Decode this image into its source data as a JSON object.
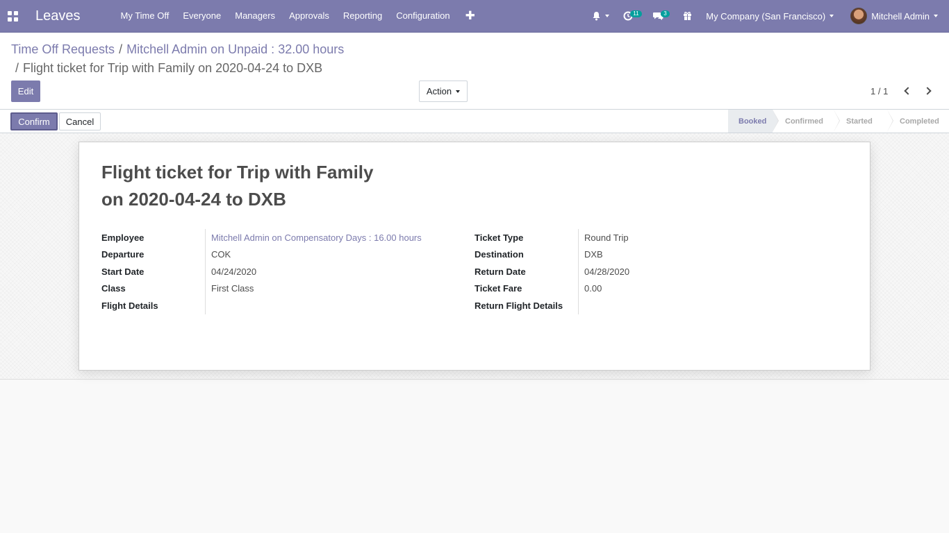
{
  "app": {
    "name": "Leaves"
  },
  "menu": [
    {
      "label": "My Time Off"
    },
    {
      "label": "Everyone"
    },
    {
      "label": "Managers"
    },
    {
      "label": "Approvals"
    },
    {
      "label": "Reporting"
    },
    {
      "label": "Configuration"
    }
  ],
  "systray": {
    "activity_count": "11",
    "messages_count": "3",
    "company": "My Company (San Francisco)",
    "user": "Mitchell Admin"
  },
  "breadcrumb": {
    "root": "Time Off Requests",
    "parent": "Mitchell Admin on Unpaid : 32.00 hours",
    "current": "Flight ticket for Trip with Family on 2020-04-24 to DXB"
  },
  "buttons": {
    "edit": "Edit",
    "action": "Action",
    "confirm": "Confirm",
    "cancel": "Cancel"
  },
  "pager": {
    "value": "1 / 1"
  },
  "stages": [
    {
      "label": "Booked",
      "active": true
    },
    {
      "label": "Confirmed",
      "active": false
    },
    {
      "label": "Started",
      "active": false
    },
    {
      "label": "Completed",
      "active": false
    }
  ],
  "record": {
    "title_line1": "Flight ticket for Trip with Family",
    "title_line2": "on 2020-04-24 to DXB",
    "left_fields": [
      {
        "label": "Employee",
        "value": "Mitchell Admin on Compensatory Days : 16.00 hours"
      },
      {
        "label": "Departure",
        "value": "COK"
      },
      {
        "label": "Start Date",
        "value": "04/24/2020"
      },
      {
        "label": "Class",
        "value": "First Class"
      },
      {
        "label": "Flight Details",
        "value": ""
      }
    ],
    "right_fields": [
      {
        "label": "Ticket Type",
        "value": "Round Trip"
      },
      {
        "label": "Destination",
        "value": "DXB"
      },
      {
        "label": "Return Date",
        "value": "04/28/2020"
      },
      {
        "label": "Ticket Fare",
        "value": "0.00"
      },
      {
        "label": "Return Flight Details",
        "value": ""
      }
    ]
  },
  "colors": {
    "brand": "#7c7bad",
    "badge": "#00a09d"
  },
  "icons": [
    "apps-icon",
    "plus-icon",
    "bell-icon",
    "activity-clock-icon",
    "chat-icon",
    "gift-icon",
    "chevron-left-icon",
    "chevron-right-icon"
  ]
}
